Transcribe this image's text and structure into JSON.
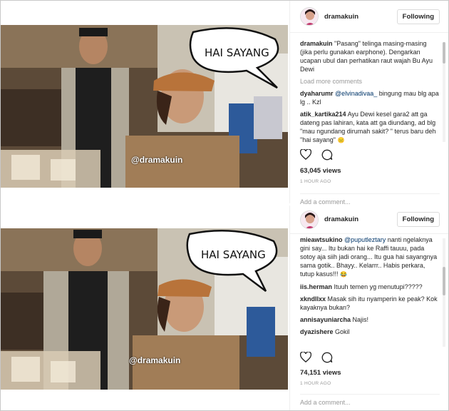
{
  "posts": [
    {
      "username": "dramakuin",
      "follow_label": "Following",
      "speech_bubble": "HAI SAYANG",
      "watermark": "@dramakuin",
      "caption_user": "dramakuin",
      "caption_text": "\"Pasang\" telinga masing-masing (jika perlu gunakan earphone). Dengarkan ucapan ubul dan perhatikan raut wajah Bu Ayu Dewi",
      "load_more": "Load more comments",
      "comments": [
        {
          "user": "dyaharumr",
          "mention": "@elvinadivaa_",
          "text": " bingung mau blg apa lg .. Kzl"
        },
        {
          "user": "atik_kartika214",
          "mention": "",
          "text": " Ayu Dewi kesel gara2 att ga dateng pas lahiran, kata att ga diundang, ad blg \"mau ngundang dirumah sakit? \" terus baru deh \"hai sayang\""
        }
      ],
      "views": "63,045 views",
      "time": "1 HOUR AGO",
      "add_comment_placeholder": "Add a comment..."
    },
    {
      "username": "dramakuin",
      "follow_label": "Following",
      "speech_bubble": "HAI SAYANG",
      "watermark": "@dramakuin",
      "comments": [
        {
          "user": "mieawtsukino",
          "mention": "@puputleztary",
          "text": " nanti ngelaknya gini say... Itu bukan hai ke Raffi tauuu, pada sotoy aja siih jadi orang... Itu gua hai sayangnya sama gotik.. Bhayy.. Kelarrr.. Habis perkara, tutup kasus!!!"
        },
        {
          "user": "iis.herman",
          "mention": "",
          "text": " Ituuh temen yg menutupi?????"
        },
        {
          "user": "xkndllxx",
          "mention": "",
          "text": " Masak sih itu nyamperin ke peak? Kok kayaknya bukan?"
        },
        {
          "user": "annisayuniarcha",
          "mention": "",
          "text": " Najis!"
        },
        {
          "user": "dyazishere",
          "mention": "",
          "text": " Gokil"
        }
      ],
      "views": "74,151 views",
      "time": "1 HOUR AGO",
      "add_comment_placeholder": "Add a comment..."
    }
  ],
  "icons": {
    "like": "heart-icon",
    "comment": "speech-bubble-icon"
  },
  "colors": {
    "mention": "#003569",
    "muted": "#999999",
    "border": "#efefef"
  }
}
